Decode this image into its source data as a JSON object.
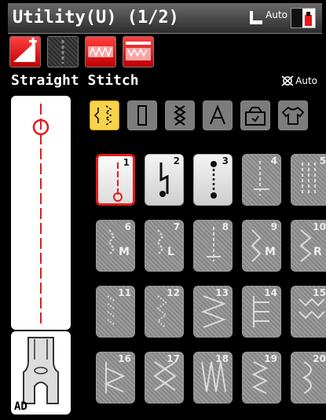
{
  "header": {
    "title": "Utility(U) (1/2)",
    "presser_auto": "Auto"
  },
  "stitch": {
    "name": "Straight Stitch",
    "tension": "Auto"
  },
  "foot": {
    "label": "AD"
  },
  "tools": [
    {
      "icon": "stitch-length-icon",
      "state": "red"
    },
    {
      "icon": "needle-position-icon",
      "state": "grey"
    },
    {
      "icon": "stitch-width-icon",
      "state": "red"
    },
    {
      "icon": "stitch-density-icon",
      "state": "red"
    }
  ],
  "categories": [
    {
      "icon": "utility-stitch-icon",
      "active": true
    },
    {
      "icon": "buttonhole-icon",
      "active": false
    },
    {
      "icon": "decorative-stitch-icon",
      "active": false
    },
    {
      "icon": "letter-icon",
      "active": false
    },
    {
      "icon": "memory-icon",
      "active": false
    },
    {
      "icon": "clothing-icon",
      "active": false
    }
  ],
  "stitches": [
    {
      "num": "1",
      "state": "selected"
    },
    {
      "num": "2",
      "state": "enabled"
    },
    {
      "num": "3",
      "state": "enabled"
    },
    {
      "num": "4",
      "state": "disabled"
    },
    {
      "num": "5",
      "state": "disabled"
    },
    {
      "num": "6",
      "state": "disabled"
    },
    {
      "num": "7",
      "state": "disabled"
    },
    {
      "num": "8",
      "state": "disabled"
    },
    {
      "num": "9",
      "state": "disabled"
    },
    {
      "num": "10",
      "state": "disabled"
    },
    {
      "num": "11",
      "state": "disabled"
    },
    {
      "num": "12",
      "state": "disabled"
    },
    {
      "num": "13",
      "state": "disabled"
    },
    {
      "num": "14",
      "state": "disabled"
    },
    {
      "num": "15",
      "state": "disabled"
    },
    {
      "num": "16",
      "state": "disabled"
    },
    {
      "num": "17",
      "state": "disabled"
    },
    {
      "num": "18",
      "state": "disabled"
    },
    {
      "num": "19",
      "state": "disabled"
    },
    {
      "num": "20",
      "state": "disabled"
    }
  ],
  "stitch_letters": {
    "6": "M",
    "7": "L",
    "9": "M",
    "10": "R"
  },
  "colors": {
    "accent_red": "#e51a1a",
    "active_tab": "#f6d34a"
  }
}
